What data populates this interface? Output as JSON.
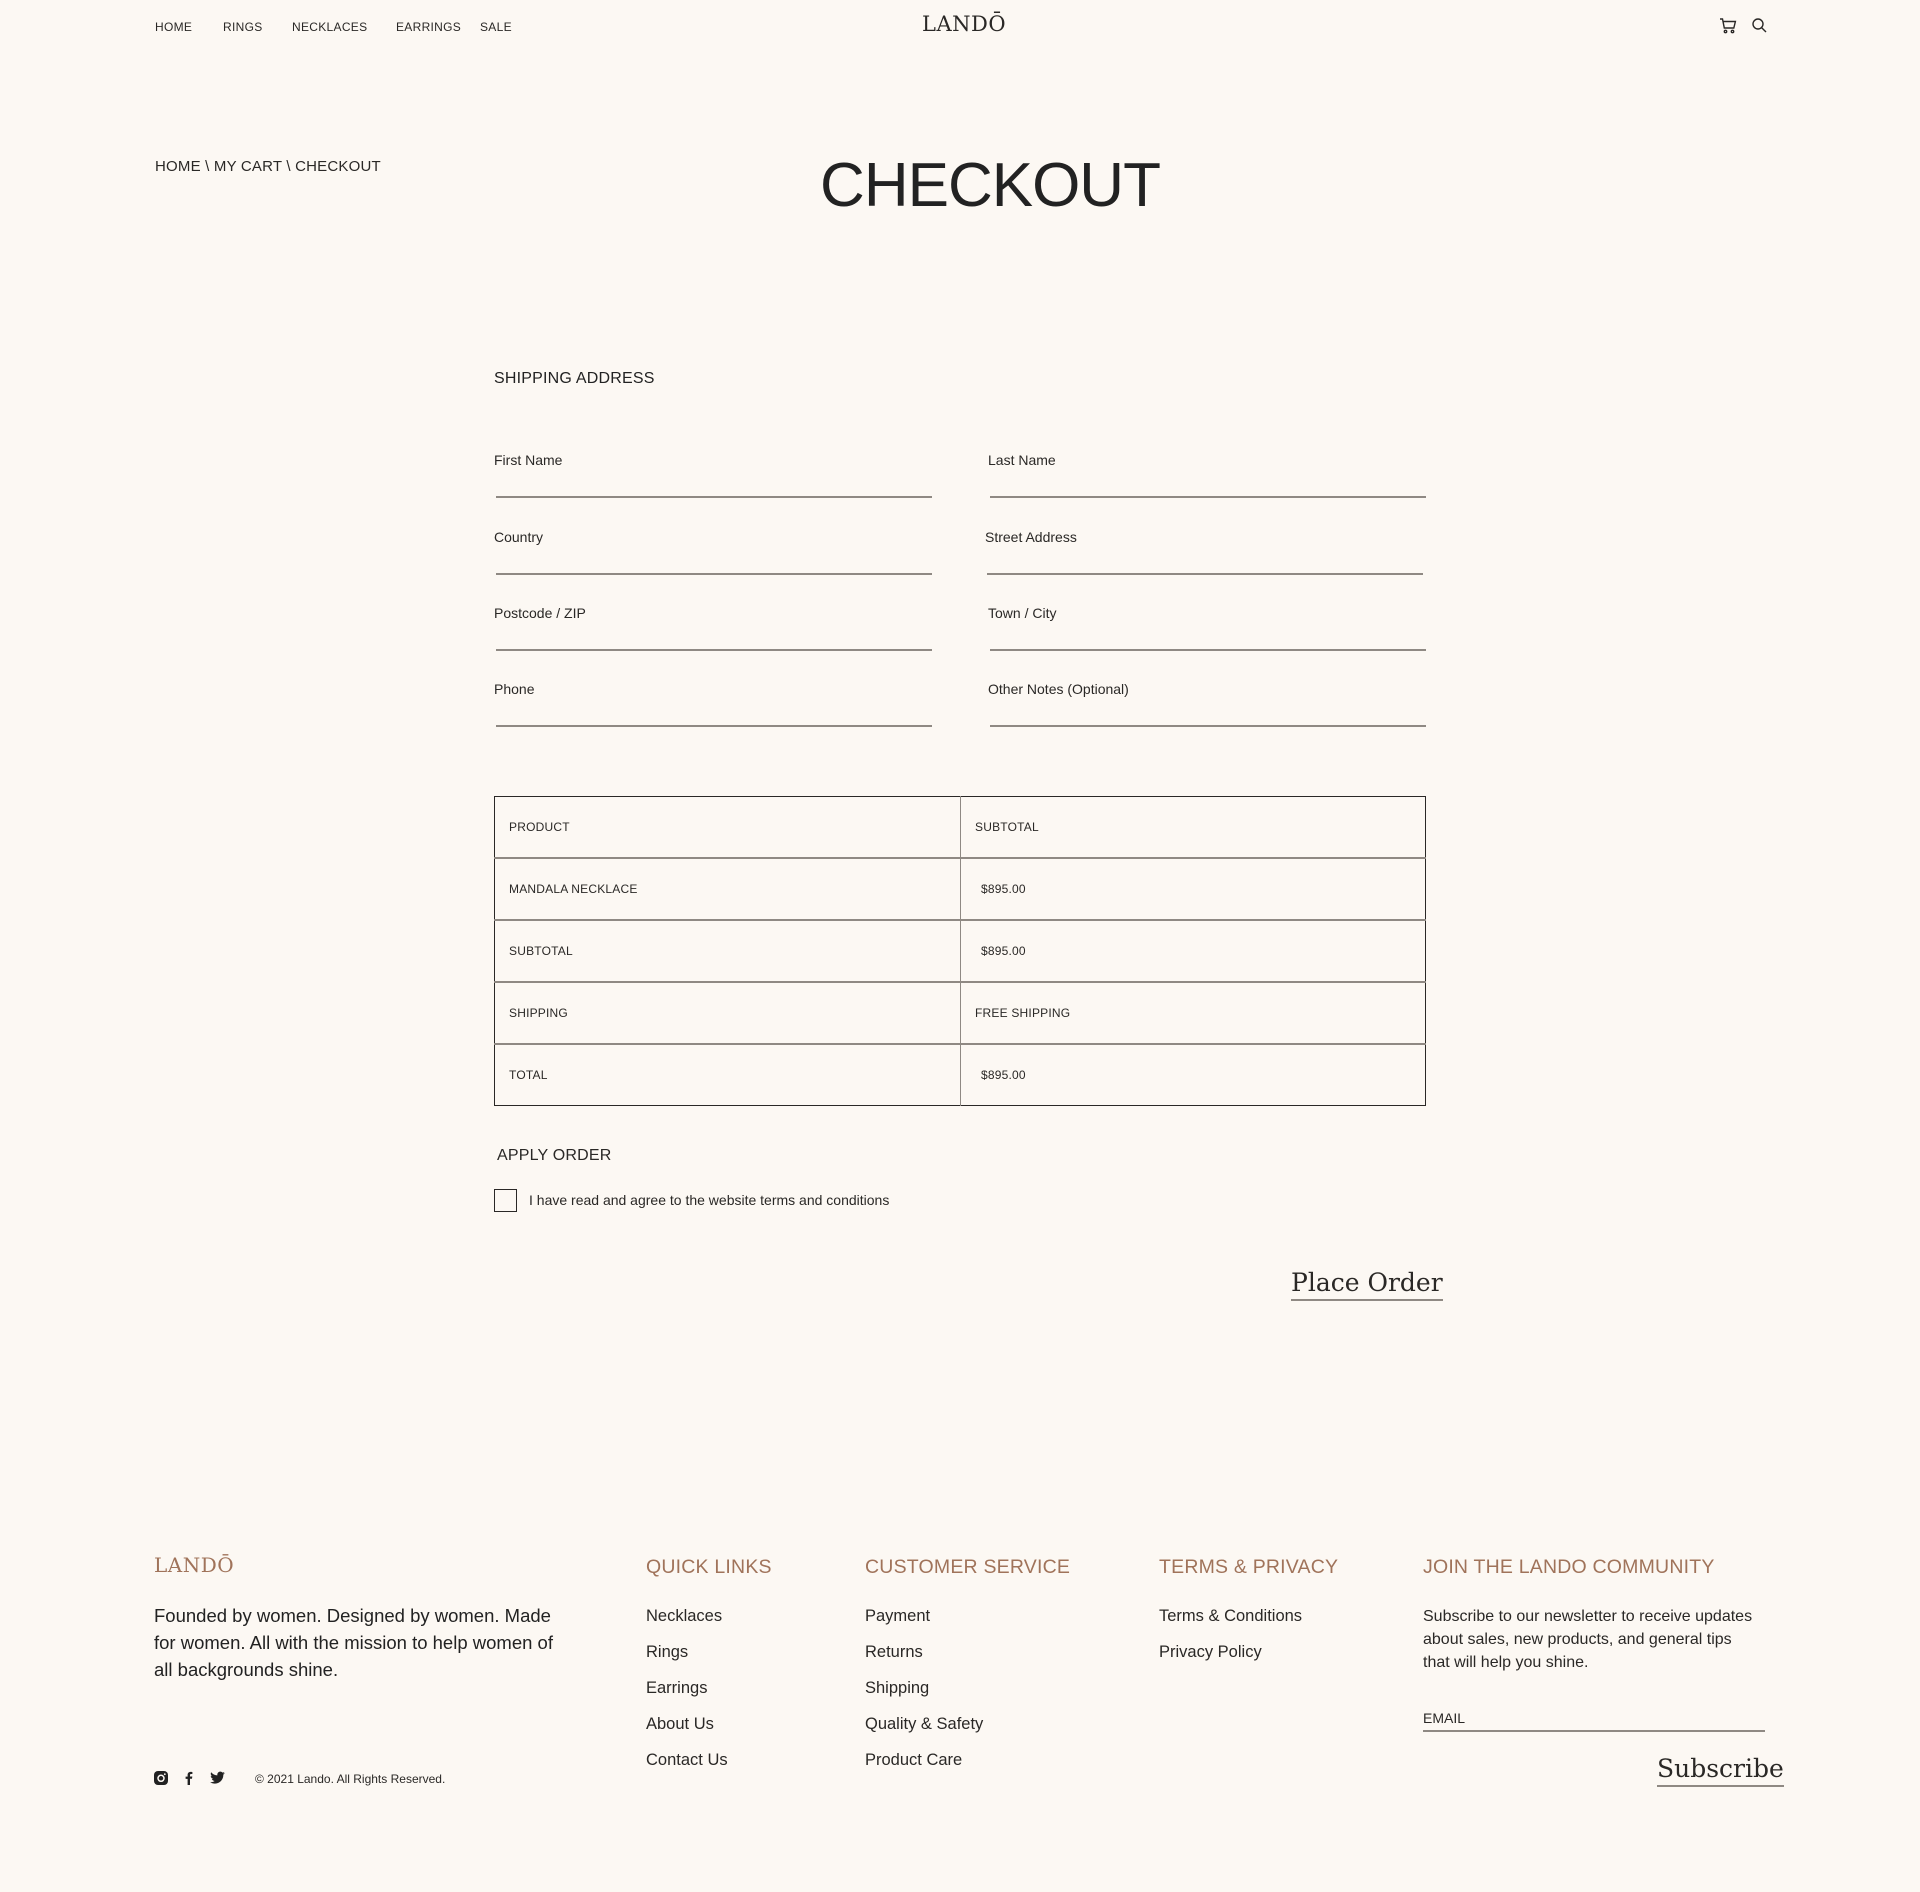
{
  "header": {
    "nav": [
      "HOME",
      "RINGS",
      "NECKLACES",
      "EARRINGS",
      "SALE"
    ],
    "logo": "LANDŌ",
    "icons": [
      "cart-icon",
      "search-icon"
    ]
  },
  "breadcrumb": "HOME \\ MY CART \\ CHECKOUT",
  "page_title": "CHECKOUT",
  "shipping": {
    "title": "SHIPPING ADDRESS",
    "fields": [
      {
        "label": "First Name",
        "value": ""
      },
      {
        "label": "Last Name",
        "value": ""
      },
      {
        "label": "Country",
        "value": ""
      },
      {
        "label": "Street Address",
        "value": ""
      },
      {
        "label": "Postcode / ZIP",
        "value": ""
      },
      {
        "label": "Town / City",
        "value": ""
      },
      {
        "label": "Phone",
        "value": ""
      },
      {
        "label": "Other Notes (Optional)",
        "value": ""
      }
    ]
  },
  "order": {
    "headers": [
      "PRODUCT",
      "SUBTOTAL"
    ],
    "rows": [
      [
        "MANDALA NECKLACE",
        "$895.00"
      ],
      [
        "SUBTOTAL",
        "$895.00"
      ],
      [
        "SHIPPING",
        "FREE SHIPPING"
      ],
      [
        "TOTAL",
        "$895.00"
      ]
    ]
  },
  "apply": {
    "title": "APPLY ORDER",
    "terms_label": "I have read and agree to the website terms and conditions",
    "terms_checked": false,
    "place_order": "Place Order"
  },
  "footer": {
    "logo": "LANDŌ",
    "about": "Founded by women. Designed by women. Made for women. All with the mission to help women of all backgrounds shine.",
    "quick_links": {
      "title": "QUICK LINKS",
      "items": [
        "Necklaces",
        "Rings",
        "Earrings",
        "About Us",
        "Contact Us"
      ]
    },
    "customer_service": {
      "title": "CUSTOMER SERVICE",
      "items": [
        "Payment",
        "Returns",
        "Shipping",
        "Quality & Safety",
        "Product Care"
      ]
    },
    "terms": {
      "title": "TERMS & PRIVACY",
      "items": [
        "Terms & Conditions",
        "Privacy Policy"
      ]
    },
    "community": {
      "title": "JOIN THE LANDO COMMUNITY",
      "text": "Subscribe to our newsletter to receive updates about sales, new products, and general tips that will help you shine.",
      "email_placeholder": "EMAIL",
      "subscribe": "Subscribe"
    },
    "social": [
      "instagram-icon",
      "facebook-icon",
      "twitter-icon"
    ],
    "copyright": "© 2021 Lando. All Rights Reserved."
  },
  "colors": {
    "background": "#fcf8f3",
    "accent": "#a0735a",
    "text": "#2a2826",
    "rule": "#8f8983"
  }
}
